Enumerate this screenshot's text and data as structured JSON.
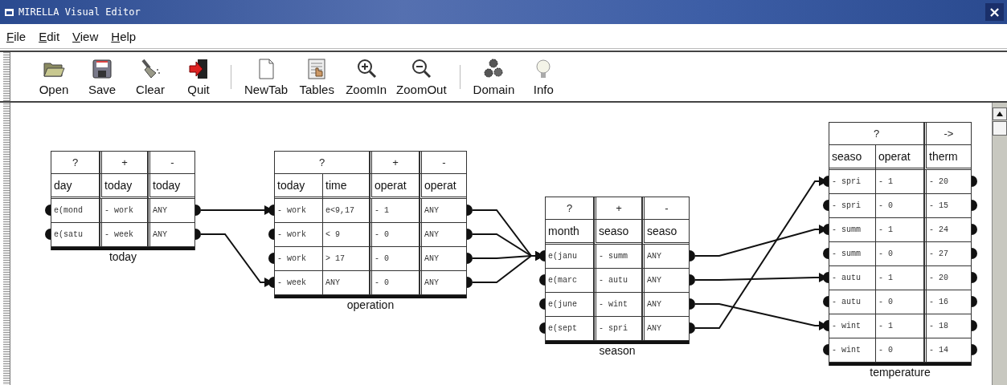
{
  "window": {
    "title": "MIRELLA Visual Editor",
    "close": "×"
  },
  "menu": [
    "File",
    "Edit",
    "View",
    "Help"
  ],
  "toolbar": [
    [
      {
        "label": "Open"
      },
      {
        "label": "Save"
      },
      {
        "label": "Clear"
      },
      {
        "label": "Quit"
      }
    ],
    [
      {
        "label": "NewTab"
      },
      {
        "label": "Tables"
      },
      {
        "label": "ZoomIn"
      },
      {
        "label": "ZoomOut"
      }
    ],
    [
      {
        "label": "Domain"
      },
      {
        "label": "Info"
      }
    ]
  ],
  "tables": [
    {
      "caption": "today",
      "groups": [
        {
          "label": "?",
          "columns": [
            "day"
          ]
        },
        {
          "label": "+",
          "columns": [
            "today"
          ]
        },
        {
          "label": "-",
          "columns": [
            "today"
          ]
        }
      ],
      "rows": [
        [
          "e(mond",
          "- work",
          "ANY"
        ],
        [
          "e(satu",
          "- week",
          "ANY"
        ]
      ]
    },
    {
      "caption": "operation",
      "groups": [
        {
          "label": "?",
          "columns": [
            "today",
            "time"
          ]
        },
        {
          "label": "+",
          "columns": [
            "operat"
          ]
        },
        {
          "label": "-",
          "columns": [
            "operat"
          ]
        }
      ],
      "rows": [
        [
          "- work",
          "e<9,17",
          "- 1",
          "ANY"
        ],
        [
          "- work",
          "< 9",
          "- 0",
          "ANY"
        ],
        [
          "- work",
          "> 17",
          "- 0",
          "ANY"
        ],
        [
          "- week",
          "ANY",
          "- 0",
          "ANY"
        ]
      ]
    },
    {
      "caption": "season",
      "groups": [
        {
          "label": "?",
          "columns": [
            "month"
          ]
        },
        {
          "label": "+",
          "columns": [
            "seaso"
          ]
        },
        {
          "label": "-",
          "columns": [
            "seaso"
          ]
        }
      ],
      "rows": [
        [
          "e(janu",
          "- summ",
          "ANY"
        ],
        [
          "e(marc",
          "- autu",
          "ANY"
        ],
        [
          "e(june",
          "- wint",
          "ANY"
        ],
        [
          "e(sept",
          "- spri",
          "ANY"
        ]
      ]
    },
    {
      "caption": "temperature",
      "groups": [
        {
          "label": "?",
          "columns": [
            "seaso",
            "operat"
          ]
        },
        {
          "label": "->",
          "columns": [
            "therm"
          ]
        }
      ],
      "rows": [
        [
          "- spri",
          "- 1",
          "- 20"
        ],
        [
          "- spri",
          "- 0",
          "- 15"
        ],
        [
          "- summ",
          "- 1",
          "- 24"
        ],
        [
          "- summ",
          "- 0",
          "- 27"
        ],
        [
          "- autu",
          "- 1",
          "- 20"
        ],
        [
          "- autu",
          "- 0",
          "- 16"
        ],
        [
          "- wint",
          "- 1",
          "- 18"
        ],
        [
          "- wint",
          "- 0",
          "- 14"
        ]
      ]
    }
  ]
}
